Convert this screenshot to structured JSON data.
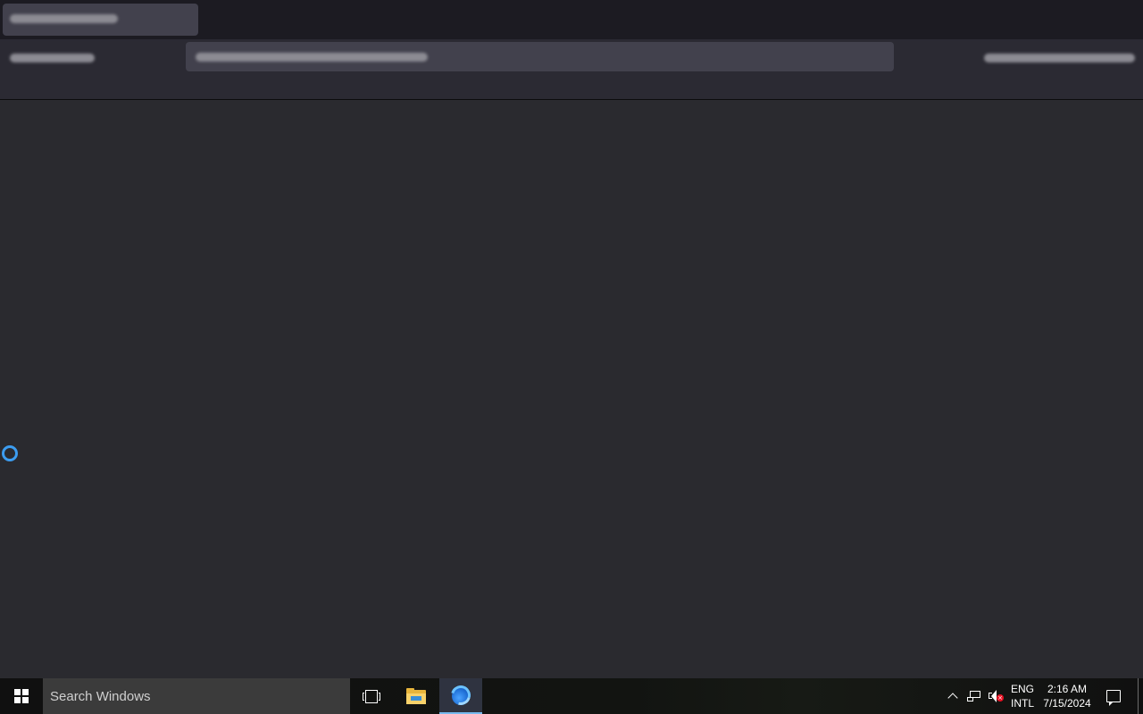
{
  "taskbar": {
    "search_placeholder": "Search Windows",
    "language": {
      "line1": "ENG",
      "line2": "INTL"
    },
    "clock": {
      "time": "2:16 AM",
      "date": "7/15/2024"
    },
    "icons": {
      "start": "windows-logo-icon",
      "task_view": "task-view-icon",
      "file_explorer": "folder-icon",
      "firefox": "firefox-icon",
      "show_hidden": "chevron-up-icon",
      "network": "network-icon",
      "volume": "volume-muted-icon",
      "notifications": "action-center-icon"
    },
    "active_app": "firefox"
  },
  "browser": {
    "state": "loading",
    "colors": {
      "tabstrip": "#1c1b22",
      "toolbar": "#2b2a33",
      "content": "#2a2a2f",
      "busy_cursor": "#3c9cf0"
    }
  }
}
